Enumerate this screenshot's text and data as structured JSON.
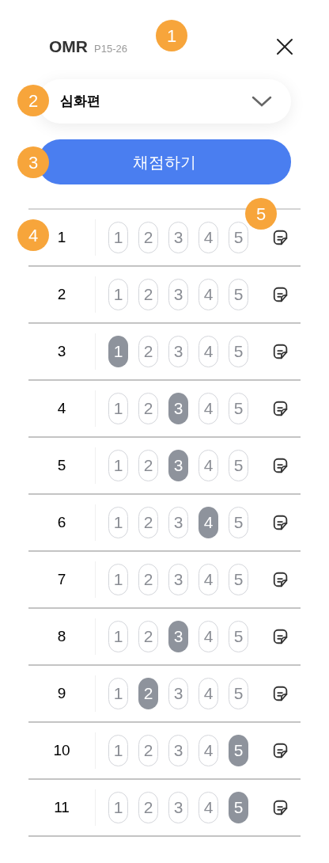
{
  "header": {
    "title": "OMR",
    "subtitle": "P15-26"
  },
  "dropdown": {
    "value": "심화편"
  },
  "submit_button": {
    "label": "채점하기"
  },
  "questions": [
    {
      "number": "1",
      "choices": [
        {
          "label": "1",
          "selected": false
        },
        {
          "label": "2",
          "selected": false
        },
        {
          "label": "3",
          "selected": false
        },
        {
          "label": "4",
          "selected": false
        },
        {
          "label": "5",
          "selected": false
        }
      ]
    },
    {
      "number": "2",
      "choices": [
        {
          "label": "1",
          "selected": false
        },
        {
          "label": "2",
          "selected": false
        },
        {
          "label": "3",
          "selected": false
        },
        {
          "label": "4",
          "selected": false
        },
        {
          "label": "5",
          "selected": false
        }
      ]
    },
    {
      "number": "3",
      "choices": [
        {
          "label": "1",
          "selected": true
        },
        {
          "label": "2",
          "selected": false
        },
        {
          "label": "3",
          "selected": false
        },
        {
          "label": "4",
          "selected": false
        },
        {
          "label": "5",
          "selected": false
        }
      ]
    },
    {
      "number": "4",
      "choices": [
        {
          "label": "1",
          "selected": false
        },
        {
          "label": "2",
          "selected": false
        },
        {
          "label": "3",
          "selected": true
        },
        {
          "label": "4",
          "selected": false
        },
        {
          "label": "5",
          "selected": false
        }
      ]
    },
    {
      "number": "5",
      "choices": [
        {
          "label": "1",
          "selected": false
        },
        {
          "label": "2",
          "selected": false
        },
        {
          "label": "3",
          "selected": true
        },
        {
          "label": "4",
          "selected": false
        },
        {
          "label": "5",
          "selected": false
        }
      ]
    },
    {
      "number": "6",
      "choices": [
        {
          "label": "1",
          "selected": false
        },
        {
          "label": "2",
          "selected": false
        },
        {
          "label": "3",
          "selected": false
        },
        {
          "label": "4",
          "selected": true
        },
        {
          "label": "5",
          "selected": false
        }
      ]
    },
    {
      "number": "7",
      "choices": [
        {
          "label": "1",
          "selected": false
        },
        {
          "label": "2",
          "selected": false
        },
        {
          "label": "3",
          "selected": false
        },
        {
          "label": "4",
          "selected": false
        },
        {
          "label": "5",
          "selected": false
        }
      ]
    },
    {
      "number": "8",
      "choices": [
        {
          "label": "1",
          "selected": false
        },
        {
          "label": "2",
          "selected": false
        },
        {
          "label": "3",
          "selected": true
        },
        {
          "label": "4",
          "selected": false
        },
        {
          "label": "5",
          "selected": false
        }
      ]
    },
    {
      "number": "9",
      "choices": [
        {
          "label": "1",
          "selected": false
        },
        {
          "label": "2",
          "selected": true
        },
        {
          "label": "3",
          "selected": false
        },
        {
          "label": "4",
          "selected": false
        },
        {
          "label": "5",
          "selected": false
        }
      ]
    },
    {
      "number": "10",
      "choices": [
        {
          "label": "1",
          "selected": false
        },
        {
          "label": "2",
          "selected": false
        },
        {
          "label": "3",
          "selected": false
        },
        {
          "label": "4",
          "selected": false
        },
        {
          "label": "5",
          "selected": true
        }
      ]
    },
    {
      "number": "11",
      "choices": [
        {
          "label": "1",
          "selected": false
        },
        {
          "label": "2",
          "selected": false
        },
        {
          "label": "3",
          "selected": false
        },
        {
          "label": "4",
          "selected": false
        },
        {
          "label": "5",
          "selected": true
        }
      ]
    }
  ],
  "callouts": [
    "1",
    "2",
    "3",
    "4",
    "5"
  ]
}
